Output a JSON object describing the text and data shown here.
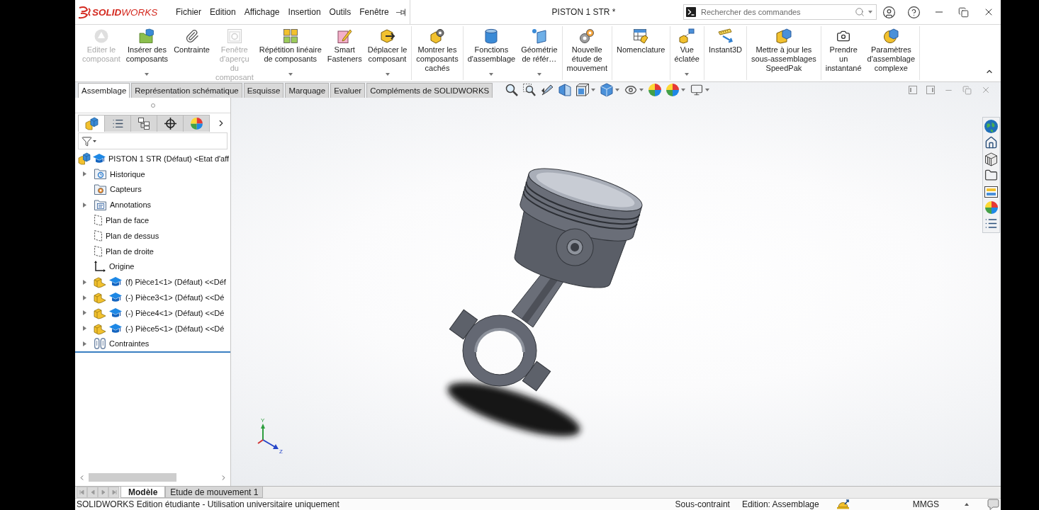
{
  "window": {
    "title": "PISTON 1 STR *"
  },
  "logo": {
    "text": "**SOLID**WORKS"
  },
  "menu": [
    "Fichier",
    "Edition",
    "Affichage",
    "Insertion",
    "Outils",
    "Fenêtre"
  ],
  "search": {
    "placeholder": "Rechercher des commandes"
  },
  "ribbon": {
    "groups": [
      {
        "buttons": [
          {
            "label": "Editer le\ncomposant",
            "disabled": true,
            "dropdown": false
          },
          {
            "label": "Insérer des\ncomposants",
            "disabled": false,
            "dropdown": true
          },
          {
            "label": "Contrainte",
            "disabled": false,
            "dropdown": false
          },
          {
            "label": "Fenêtre\nd'aperçu\ndu\ncomposant",
            "disabled": true,
            "dropdown": false
          },
          {
            "label": "Répétition linéaire\nde composants",
            "disabled": false,
            "dropdown": true
          },
          {
            "label": "Smart\nFasteners",
            "disabled": false,
            "dropdown": false
          },
          {
            "label": "Déplacer le\ncomposant",
            "disabled": false,
            "dropdown": true
          }
        ]
      },
      {
        "buttons": [
          {
            "label": "Montrer les\ncomposants\ncachés",
            "disabled": false,
            "dropdown": false
          }
        ]
      },
      {
        "buttons": [
          {
            "label": "Fonctions\nd'assemblage",
            "disabled": false,
            "dropdown": true
          },
          {
            "label": "Géométrie\nde référ…",
            "disabled": false,
            "dropdown": true
          }
        ]
      },
      {
        "buttons": [
          {
            "label": "Nouvelle\nétude de\nmouvement",
            "disabled": false,
            "dropdown": false
          }
        ]
      },
      {
        "buttons": [
          {
            "label": "Nomenclature",
            "disabled": false,
            "dropdown": false
          }
        ]
      },
      {
        "buttons": [
          {
            "label": "Vue\néclatée",
            "disabled": false,
            "dropdown": true
          }
        ]
      },
      {
        "buttons": [
          {
            "label": "Instant3D",
            "disabled": false,
            "dropdown": false
          }
        ]
      },
      {
        "buttons": [
          {
            "label": "Mettre à jour les\nsous-assemblages\nSpeedPak",
            "disabled": false,
            "dropdown": false
          }
        ]
      },
      {
        "buttons": [
          {
            "label": "Prendre\nun\ninstantané",
            "disabled": false,
            "dropdown": false
          },
          {
            "label": "Paramètres\nd'assemblage\ncomplexe",
            "disabled": false,
            "dropdown": false
          }
        ]
      }
    ]
  },
  "command_tabs": [
    {
      "label": "Assemblage",
      "selected": true
    },
    {
      "label": "Représentation schématique",
      "selected": false
    },
    {
      "label": "Esquisse",
      "selected": false
    },
    {
      "label": "Marquage",
      "selected": false
    },
    {
      "label": "Evaluer",
      "selected": false
    },
    {
      "label": "Compléments de SOLIDWORKS",
      "selected": false
    }
  ],
  "feature_tree": {
    "panel_tabs": [
      {
        "selected": true
      },
      {
        "selected": false
      },
      {
        "selected": false
      },
      {
        "selected": false
      },
      {
        "selected": false
      }
    ],
    "root": {
      "label": "PISTON 1 STR (Défaut) <Etat d'aff",
      "kind": "assembly",
      "children": [
        {
          "label": "Historique",
          "kind": "history",
          "expanded": false
        },
        {
          "label": "Capteurs",
          "kind": "sensor"
        },
        {
          "label": "Annotations",
          "kind": "annotation",
          "expanded": false
        },
        {
          "label": "Plan de face",
          "kind": "plane"
        },
        {
          "label": "Plan de dessus",
          "kind": "plane"
        },
        {
          "label": "Plan de droite",
          "kind": "plane"
        },
        {
          "label": "Origine",
          "kind": "origin"
        },
        {
          "label": "(f) Pièce1<1> (Défaut) <<Déf",
          "kind": "part",
          "expanded": false
        },
        {
          "label": "(-) Pièce3<1> (Défaut) <<Dé",
          "kind": "part",
          "expanded": false
        },
        {
          "label": "(-) Pièce4<1> (Défaut) <<Dé",
          "kind": "part",
          "expanded": false
        },
        {
          "label": "(-) Pièce5<1> (Défaut) <<Dé",
          "kind": "part",
          "expanded": false
        },
        {
          "label": "Contraintes",
          "kind": "mates",
          "expanded": false
        }
      ]
    }
  },
  "graphics": {
    "triad": {
      "y_label": "Y",
      "z_label": "Z"
    }
  },
  "model_tabs": [
    {
      "label": "Modèle",
      "selected": true
    },
    {
      "label": "Etude de mouvement 1",
      "selected": false
    }
  ],
  "status_bar": {
    "notice": "SOLIDWORKS Edition étudiante - Utilisation universitaire uniquement",
    "constraint_state": "Sous-contraint",
    "edit_mode": "Edition: Assemblage",
    "units": "MMGS"
  }
}
